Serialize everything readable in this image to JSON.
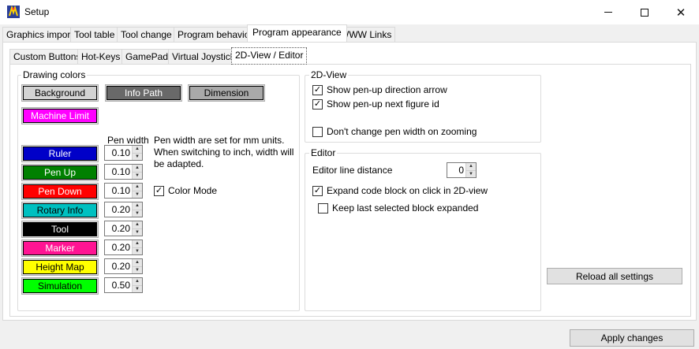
{
  "window": {
    "title": "Setup",
    "icon": "app-icon"
  },
  "main_tabs": [
    "Graphics import",
    "Tool table",
    "Tool change",
    "Program behavior",
    "Program appearance",
    "WWW Links"
  ],
  "sub_tabs": [
    "Custom Buttons",
    "Hot-Keys",
    "GamePad",
    "Virtual Joystick",
    "2D-View / Editor"
  ],
  "drawing_colors": {
    "title": "Drawing colors",
    "background_label": "Background",
    "info_path_label": "Info Path",
    "dimension_label": "Dimension",
    "machine_limit_label": "Machine Limit",
    "pen_width_header": "Pen width",
    "note": "Pen width are set for mm units. When switching to inch, width will be adapted.",
    "color_mode_label": "Color Mode",
    "color_mode_checked": true,
    "rows": [
      {
        "label": "Ruler",
        "pen_width": "0.10",
        "color": "#0000c8",
        "text_color": "#ffffff"
      },
      {
        "label": "Pen Up",
        "pen_width": "0.10",
        "color": "#008000",
        "text_color": "#ffffff"
      },
      {
        "label": "Pen Down",
        "pen_width": "0.10",
        "color": "#ff0000",
        "text_color": "#ffffff"
      },
      {
        "label": "Rotary Info",
        "pen_width": "0.20",
        "color": "#00c0c0",
        "text_color": "#000000"
      },
      {
        "label": "Tool",
        "pen_width": "0.20",
        "color": "#000000",
        "text_color": "#ffffff"
      },
      {
        "label": "Marker",
        "pen_width": "0.20",
        "color": "#ff1493",
        "text_color": "#ffffff"
      },
      {
        "label": "Height Map",
        "pen_width": "0.20",
        "color": "#ffff00",
        "text_color": "#000000"
      },
      {
        "label": "Simulation",
        "pen_width": "0.50",
        "color": "#00ff00",
        "text_color": "#000000"
      }
    ],
    "colors": {
      "background": "#d3d3d3",
      "info_path": "#696969",
      "dimension": "#a9a9a9",
      "machine_limit": "#ff00ff"
    }
  },
  "view2d": {
    "title": "2D-View",
    "show_arrow_label": "Show pen-up direction arrow",
    "show_arrow_checked": true,
    "show_figure_label": "Show pen-up next figure id",
    "show_figure_checked": true,
    "dont_change_label": "Don't change pen width on zooming",
    "dont_change_checked": false
  },
  "editor": {
    "title": "Editor",
    "line_distance_label": "Editor line distance",
    "line_distance_value": "0",
    "expand_label": "Expand code block on click in 2D-view",
    "expand_checked": true,
    "keep_label": "Keep last selected block expanded",
    "keep_checked": false
  },
  "reload_label": "Reload all settings",
  "apply_label": "Apply changes"
}
